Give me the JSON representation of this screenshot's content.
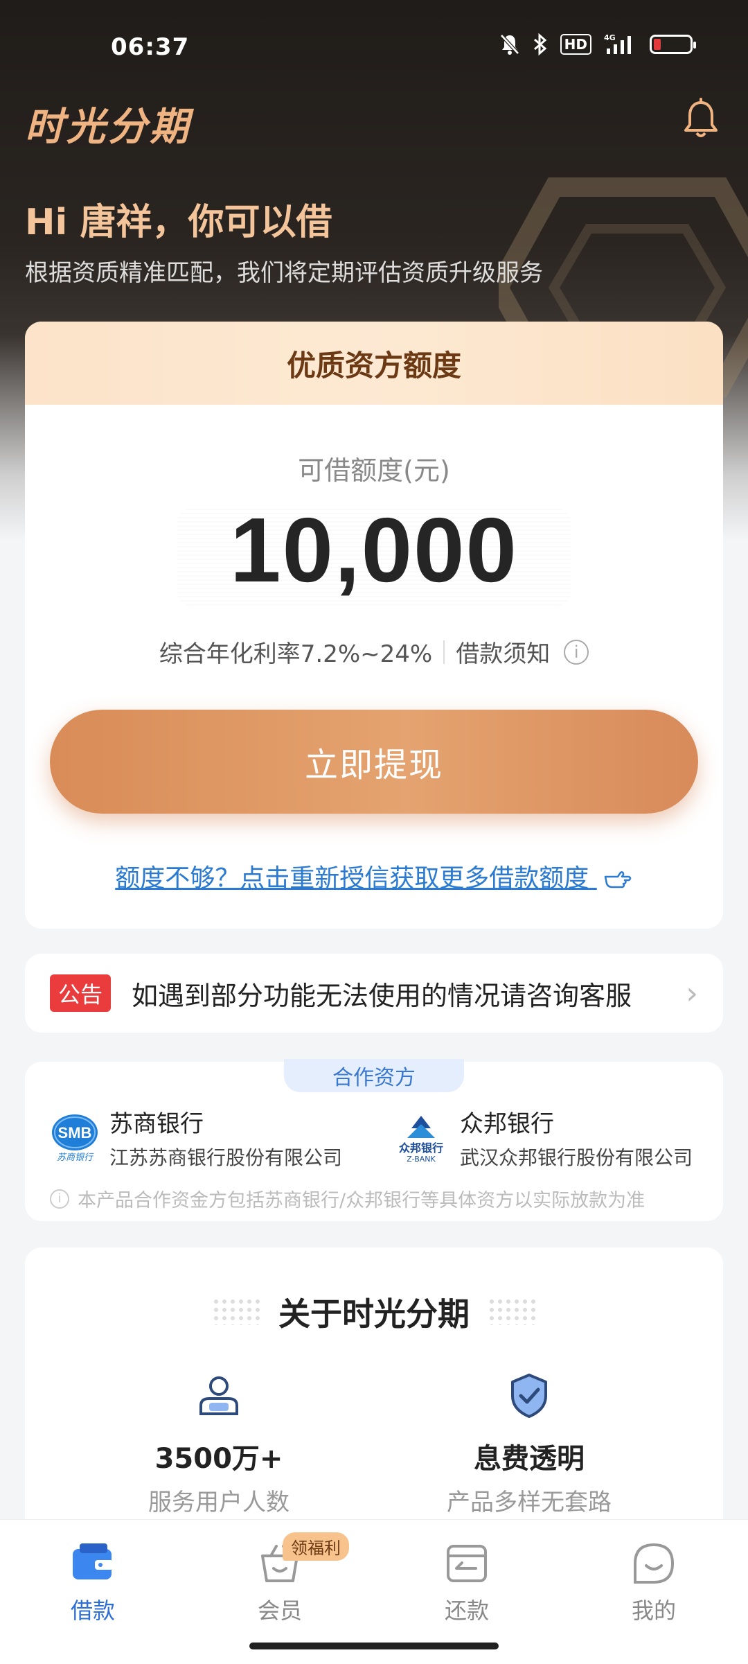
{
  "status_bar": {
    "time": "06:37",
    "hd": "HD",
    "network": "4G",
    "icons": [
      "bell-off-icon",
      "bluetooth-icon",
      "hd-icon",
      "signal-icon",
      "battery-low-icon"
    ]
  },
  "header": {
    "app_title": "时光分期",
    "greeting": "Hi 唐祥，你可以借",
    "subtitle": "根据资质精准匹配，我们将定期评估资质升级服务"
  },
  "quota": {
    "card_title": "优质资方额度",
    "label": "可借额度(元)",
    "amount": "10,000",
    "rate": "综合年化利率7.2%~24%",
    "notice_link": "借款须知",
    "withdraw_label": "立即提现",
    "reapply_link": "额度不够？点击重新授信获取更多借款额度"
  },
  "announcement": {
    "badge": "公告",
    "text": "如遇到部分功能无法使用的情况请咨询客服"
  },
  "partners": {
    "tab_label": "合作资方",
    "items": [
      {
        "name": "苏商银行",
        "corp": "江苏苏商银行股份有限公司",
        "logo_text": "SMB",
        "logo_sub": "苏商银行"
      },
      {
        "name": "众邦银行",
        "corp": "武汉众邦银行股份有限公司",
        "logo_text": "众邦银行",
        "logo_sub": "Z-BANK"
      }
    ],
    "note": "本产品合作资金方包括苏商银行/众邦银行等具体资方以实际放款为准"
  },
  "about": {
    "title": "关于时光分期",
    "features": [
      {
        "value": "3500万+",
        "desc": "服务用户人数",
        "icon": "user-icon"
      },
      {
        "value": "息费透明",
        "desc": "产品多样无套路",
        "icon": "shield-check-icon"
      }
    ]
  },
  "tabbar": {
    "items": [
      {
        "label": "借款",
        "icon": "wallet-icon",
        "active": true
      },
      {
        "label": "会员",
        "icon": "basket-icon",
        "badge": "领福利"
      },
      {
        "label": "还款",
        "icon": "card-icon"
      },
      {
        "label": "我的",
        "icon": "smile-icon"
      }
    ]
  },
  "colors": {
    "accent": "#e4a370",
    "link": "#2a7ad1",
    "active_tab": "#2e6fd6",
    "badge_red": "#ea3c3c"
  }
}
